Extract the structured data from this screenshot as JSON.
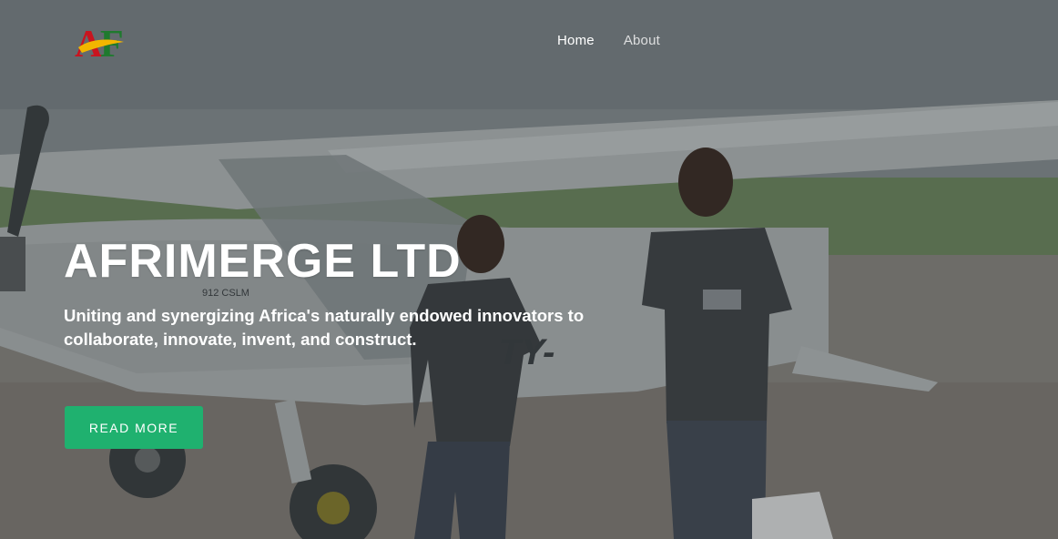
{
  "brand": {
    "logo_text": "AF",
    "logo_colors": {
      "a": "#c9141f",
      "f": "#1f7a2e",
      "swoosh": "#f2b600"
    }
  },
  "nav": {
    "items": [
      {
        "label": "Home",
        "active": true
      },
      {
        "label": "About",
        "active": false
      }
    ]
  },
  "hero": {
    "title": "AFRIMERGE LTD",
    "subtitle": "Uniting and synergizing Africa's naturally endowed innovators to collaborate, innovate, invent, and construct.",
    "cta_label": "READ MORE",
    "background_icon": "airplane-photo"
  },
  "colors": {
    "accent": "#1fb16f",
    "text": "#ffffff"
  }
}
